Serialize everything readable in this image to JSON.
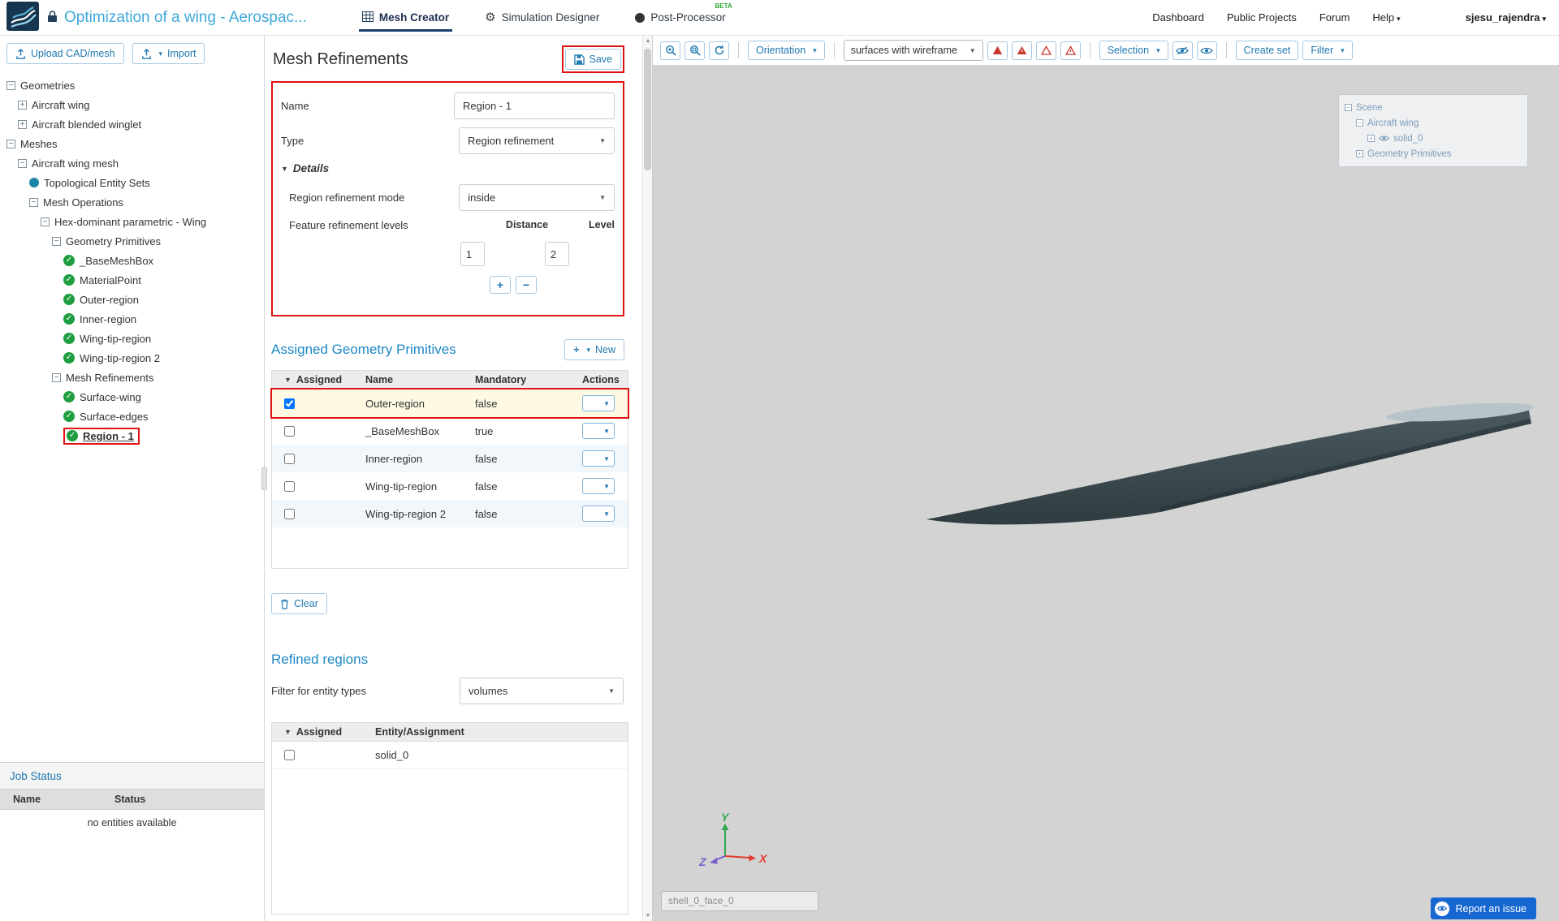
{
  "header": {
    "title": "Optimization of a wing - Aerospac...",
    "tabs": {
      "mesh_creator": "Mesh Creator",
      "simulation_designer": "Simulation Designer",
      "post_processor": "Post-Processor",
      "post_processor_badge": "BETA"
    },
    "nav": {
      "dashboard": "Dashboard",
      "public_projects": "Public Projects",
      "forum": "Forum",
      "help": "Help",
      "user": "sjesu_rajendra"
    }
  },
  "sidebar": {
    "upload_label": "Upload CAD/mesh",
    "import_label": "Import",
    "tree": [
      {
        "label": "Geometries"
      },
      {
        "label": "Aircraft wing"
      },
      {
        "label": "Aircraft blended winglet"
      },
      {
        "label": "Meshes"
      },
      {
        "label": "Aircraft wing mesh"
      },
      {
        "label": "Topological Entity Sets"
      },
      {
        "label": "Mesh Operations"
      },
      {
        "label": "Hex-dominant parametric - Wing"
      },
      {
        "label": "Geometry Primitives"
      },
      {
        "label": "_BaseMeshBox"
      },
      {
        "label": "MaterialPoint"
      },
      {
        "label": "Outer-region"
      },
      {
        "label": "Inner-region"
      },
      {
        "label": "Wing-tip-region"
      },
      {
        "label": "Wing-tip-region 2"
      },
      {
        "label": "Mesh Refinements"
      },
      {
        "label": "Surface-wing"
      },
      {
        "label": "Surface-edges"
      },
      {
        "label": "Region - 1"
      }
    ],
    "job_status": {
      "title": "Job Status",
      "col_name": "Name",
      "col_status": "Status",
      "empty": "no entities available"
    }
  },
  "panel": {
    "title": "Mesh Refinements",
    "save": "Save",
    "form": {
      "name_label": "Name",
      "name_value": "Region - 1",
      "type_label": "Type",
      "type_value": "Region refinement",
      "details_label": "Details",
      "mode_label": "Region refinement mode",
      "mode_value": "inside",
      "feature_label": "Feature refinement levels",
      "distance_header": "Distance",
      "level_header": "Level",
      "distance_value": "1",
      "level_value": "2"
    },
    "assigned": {
      "title": "Assigned Geometry Primitives",
      "new_label": "New",
      "col_assigned": "Assigned",
      "col_name": "Name",
      "col_mandatory": "Mandatory",
      "col_actions": "Actions",
      "rows": [
        {
          "name": "Outer-region",
          "mandatory": "false"
        },
        {
          "name": "_BaseMeshBox",
          "mandatory": "true"
        },
        {
          "name": "Inner-region",
          "mandatory": "false"
        },
        {
          "name": "Wing-tip-region",
          "mandatory": "false"
        },
        {
          "name": "Wing-tip-region 2",
          "mandatory": "false"
        }
      ],
      "clear_label": "Clear"
    },
    "refined": {
      "title": "Refined regions",
      "filter_label": "Filter for entity types",
      "filter_value": "volumes",
      "col_assigned": "Assigned",
      "col_entity": "Entity/Assignment",
      "rows": [
        {
          "name": "solid_0"
        }
      ]
    }
  },
  "viewport": {
    "toolbar": {
      "orientation": "Orientation",
      "display_mode": "surfaces with wireframe",
      "selection": "Selection",
      "create_set": "Create set",
      "filter": "Filter"
    },
    "scene_tree": {
      "scene": "Scene",
      "aircraft_wing": "Aircraft wing",
      "solid": "solid_0",
      "geometry_primitives": "Geometry Primitives"
    },
    "face_label": "shell_0_face_0",
    "report_issue": "Report an issue",
    "axes": {
      "x": "X",
      "y": "Y",
      "z": "Z"
    }
  },
  "icons": {
    "caret": "▾",
    "select_caret": "▼",
    "tri_down": "▼",
    "plus": "+",
    "minus": "−",
    "check": "✓",
    "collapse": "−",
    "expand": "+",
    "gear": "⚙",
    "up": "▲",
    "down": "▼"
  },
  "colors": {
    "accent_blue": "#2079b0",
    "heading_teal": "#1d88c7",
    "annotation_red": "#e11212",
    "check_green": "#1e9e3e",
    "header_title_blue": "#3fa9dc",
    "viewport_bg": "#d3d3d3",
    "wing_dark": "#3c4c50",
    "report_blue": "#1767d2"
  }
}
